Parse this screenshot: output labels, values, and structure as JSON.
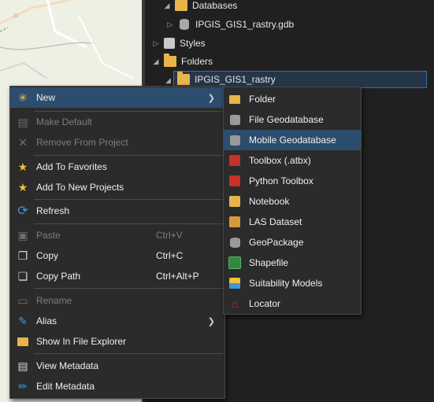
{
  "catalog": {
    "databases_label": "Databases",
    "gdb_label": "IPGIS_GIS1_rastry.gdb",
    "styles_label": "Styles",
    "folders_label": "Folders",
    "folder_item_label": "IPGIS_GIS1_rastry"
  },
  "context_menu": {
    "new": "New",
    "make_default": "Make Default",
    "remove_from_project": "Remove From Project",
    "add_to_favorites": "Add To Favorites",
    "add_to_new_projects": "Add To New Projects",
    "refresh": "Refresh",
    "paste": "Paste",
    "paste_shortcut": "Ctrl+V",
    "copy": "Copy",
    "copy_shortcut": "Ctrl+C",
    "copy_path": "Copy Path",
    "copy_path_shortcut": "Ctrl+Alt+P",
    "rename": "Rename",
    "alias": "Alias",
    "show_in_file_explorer": "Show In File Explorer",
    "view_metadata": "View Metadata",
    "edit_metadata": "Edit Metadata"
  },
  "new_submenu": {
    "folder": "Folder",
    "file_geodatabase": "File Geodatabase",
    "mobile_geodatabase": "Mobile Geodatabase",
    "toolbox": "Toolbox (.atbx)",
    "python_toolbox": "Python Toolbox",
    "notebook": "Notebook",
    "las_dataset": "LAS Dataset",
    "geopackage": "GeoPackage",
    "shapefile": "Shapefile",
    "suitability_models": "Suitability Models",
    "locator": "Locator"
  },
  "colors": {
    "menu_bg": "#2b2b2b",
    "highlight": "#2d4d6e",
    "folder": "#e8b44a",
    "star": "#f2c230",
    "refresh": "#3f97e0"
  }
}
